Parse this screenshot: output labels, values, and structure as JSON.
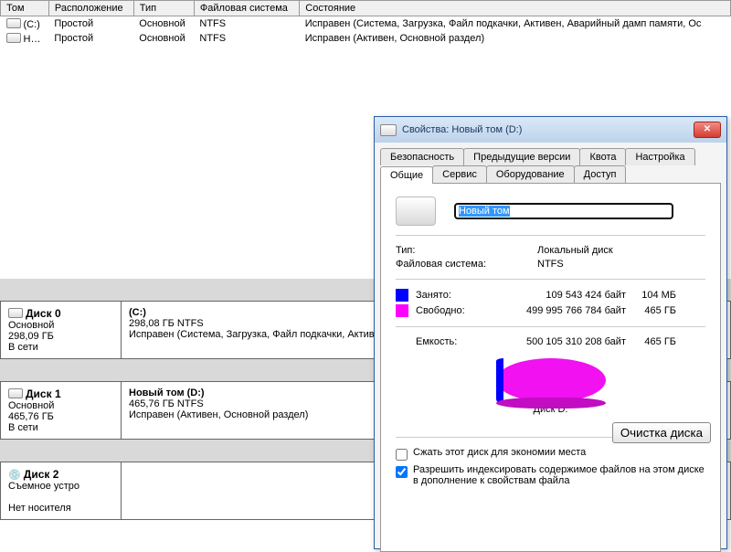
{
  "volumes": {
    "headers": {
      "vol": "Том",
      "layout": "Расположение",
      "type": "Тип",
      "fs": "Файловая система",
      "status": "Состояние"
    },
    "rows": [
      {
        "vol": "(C:)",
        "layout": "Простой",
        "type": "Основной",
        "fs": "NTFS",
        "status": "Исправен (Система, Загрузка, Файл подкачки, Активен, Аварийный дамп памяти, Ос"
      },
      {
        "vol": "Н…",
        "layout": "Простой",
        "type": "Основной",
        "fs": "NTFS",
        "status": "Исправен (Активен, Основной раздел)"
      }
    ]
  },
  "disks": [
    {
      "name": "Диск 0",
      "type": "Основной",
      "size": "298,09 ГБ",
      "state": "В сети",
      "part": {
        "title": "(C:)",
        "info": "298,08 ГБ NTFS",
        "status": "Исправен (Система, Загрузка, Файл подкачки, Активен"
      }
    },
    {
      "name": "Диск 1",
      "type": "Основной",
      "size": "465,76 ГБ",
      "state": "В сети",
      "part": {
        "title": "Новый том (D:)",
        "info": "465,76 ГБ NTFS",
        "status": "Исправен (Активен, Основной раздел)"
      }
    },
    {
      "name": "Диск 2",
      "type": "Съемное устро",
      "size": "",
      "state": "Нет носителя",
      "part": null
    }
  ],
  "dialog": {
    "title": "Свойства: Новый том (D:)",
    "tabs_top": [
      "Безопасность",
      "Предыдущие версии",
      "Квота",
      "Настройка"
    ],
    "tabs_bot": [
      "Общие",
      "Сервис",
      "Оборудование",
      "Доступ"
    ],
    "active_tab": "Общие",
    "volume_name": "Новый том",
    "fields": {
      "type_l": "Тип:",
      "type_v": "Локальный диск",
      "fs_l": "Файловая система:",
      "fs_v": "NTFS"
    },
    "used": {
      "label": "Занято:",
      "bytes": "109 543 424 байт",
      "unit": "104 МБ",
      "color": "#0000ff"
    },
    "free": {
      "label": "Свободно:",
      "bytes": "499 995 766 784 байт",
      "unit": "465 ГБ",
      "color": "#ff00ff"
    },
    "capacity": {
      "label": "Емкость:",
      "bytes": "500 105 310 208 байт",
      "unit": "465 ГБ"
    },
    "pie_label": "Диск D:",
    "cleanup": "Очистка диска",
    "compress": "Сжать этот диск для экономии места",
    "index": "Разрешить индексировать содержимое файлов на этом диске в дополнение к свойствам файла"
  },
  "chart_data": {
    "type": "pie",
    "title": "Диск D:",
    "series": [
      {
        "name": "Занято",
        "value": 109543424,
        "unit": "байт",
        "color": "#0000ff"
      },
      {
        "name": "Свободно",
        "value": 499995766784,
        "unit": "байт",
        "color": "#ff00ff"
      }
    ],
    "total": 500105310208
  }
}
